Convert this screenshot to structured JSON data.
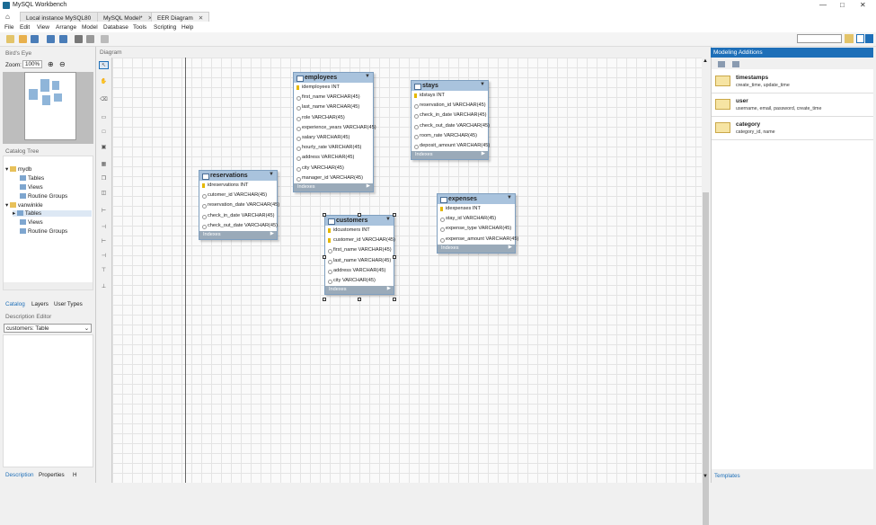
{
  "window": {
    "title": "MySQL Workbench"
  },
  "tabs": [
    {
      "label": "Local instance MySQL80"
    },
    {
      "label": "MySQL Model*"
    },
    {
      "label": "EER Diagram"
    }
  ],
  "menu": [
    "File",
    "Edit",
    "View",
    "Arrange",
    "Model",
    "Database",
    "Tools",
    "Scripting",
    "Help"
  ],
  "left": {
    "birds_eye_title": "Bird's Eye",
    "zoom_label": "Zoom:",
    "zoom_value": "100%",
    "catalog_title": "Catalog Tree",
    "tree": [
      {
        "label": "mydb"
      },
      {
        "label": "Tables"
      },
      {
        "label": "Views"
      },
      {
        "label": "Routine Groups"
      },
      {
        "label": "vanwinkle"
      },
      {
        "label": "Tables"
      },
      {
        "label": "Views"
      },
      {
        "label": "Routine Groups"
      }
    ],
    "subtabs": [
      "Catalog",
      "Layers",
      "User Types"
    ],
    "desc_title": "Description Editor",
    "desc_select": "customers: Table",
    "bottom_tabs": [
      "Description",
      "Properties",
      "H"
    ]
  },
  "diagram": {
    "title": "Diagram",
    "tables": [
      {
        "name": "employees",
        "rows": [
          "idemployees INT",
          "first_name VARCHAR(45)",
          "last_name VARCHAR(45)",
          "role VARCHAR(45)",
          "experience_years VARCHAR(45)",
          "salary VARCHAR(45)",
          "hourly_rate VARCHAR(45)",
          "address VARCHAR(45)",
          "city VARCHAR(45)",
          "manager_id VARCHAR(45)"
        ],
        "indexes": "Indexes"
      },
      {
        "name": "stays",
        "rows": [
          "idstays INT",
          "reservation_id VARCHAR(45)",
          "check_in_date VARCHAR(45)",
          "check_out_date VARCHAR(45)",
          "room_rate VARCHAR(45)",
          "deposit_amount VARCHAR(45)"
        ],
        "indexes": "Indexes"
      },
      {
        "name": "reservations",
        "rows": [
          "idreservations INT",
          "cutomer_id VARCHAR(45)",
          "reservation_date VARCHAR(45)",
          "check_in_date VARCHAR(45)",
          "check_out_date VARCHAR(45)"
        ],
        "indexes": "Indexes"
      },
      {
        "name": "customers",
        "rows": [
          "idcustomers INT",
          "customer_id VARCHAR(45)",
          "first_name VARCHAR(45)",
          "last_name VARCHAR(45)",
          "address VARCHAR(45)",
          "city VARCHAR(45)"
        ],
        "indexes": "Indexes"
      },
      {
        "name": "expenses",
        "rows": [
          "idexpenses INT",
          "stay_id VARCHAR(45)",
          "expense_type VARCHAR(45)",
          "expense_amount VARCHAR(45)"
        ],
        "indexes": "Indexes"
      }
    ]
  },
  "right": {
    "title": "Modeling Additions",
    "items": [
      {
        "name": "timestamps",
        "desc": "create_time, update_time"
      },
      {
        "name": "user",
        "desc": "username, email, password, create_time"
      },
      {
        "name": "category",
        "desc": "category_id, name"
      }
    ],
    "bottom_tab": "Templates"
  }
}
